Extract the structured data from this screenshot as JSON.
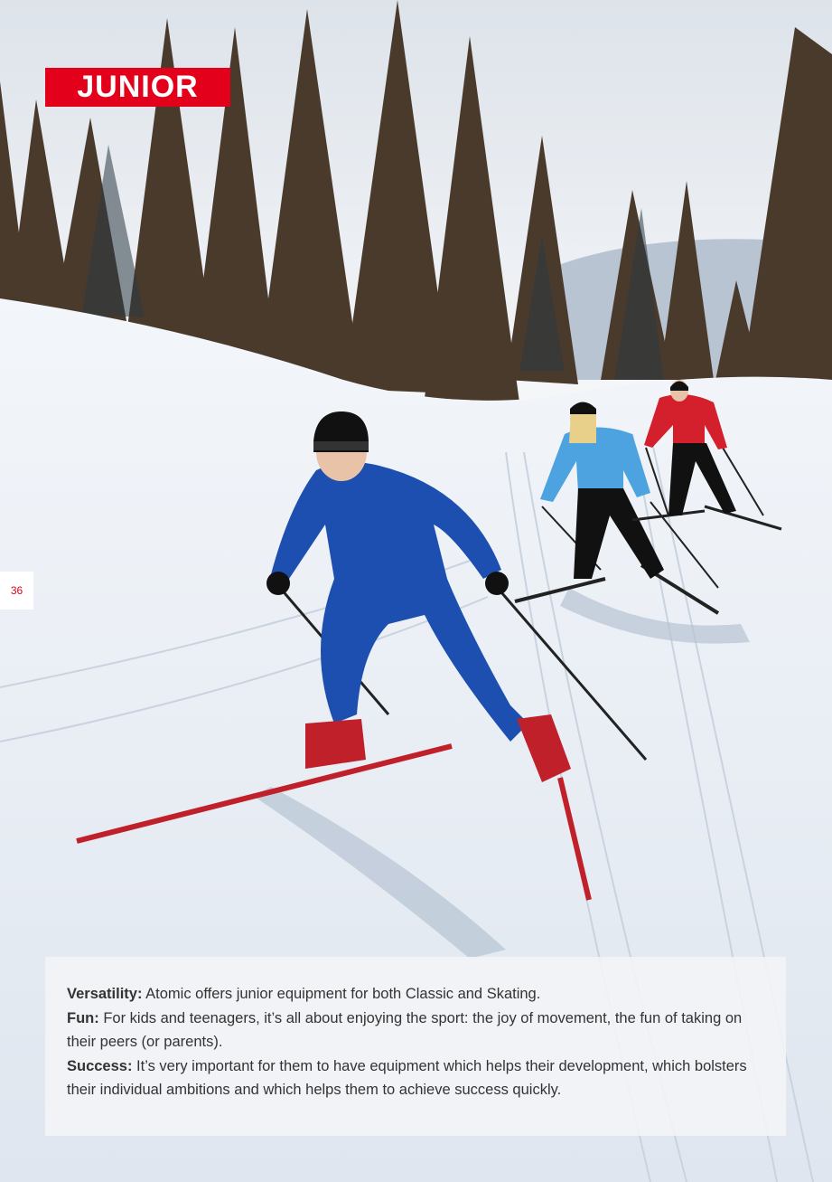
{
  "page": {
    "title": "JUNIOR",
    "page_number": "36"
  },
  "colors": {
    "accent": "#e3001b",
    "snow": "#eef2f7",
    "sky": "#f4f6f8",
    "skier_main_suit": "#1d4fb0",
    "skier_blonde_jacket": "#4da3e0",
    "skier_right_jacket": "#d4202c"
  },
  "text": {
    "paragraphs": [
      {
        "label": "Versatility:",
        "body": " Atomic offers junior equipment for both Classic and Skating."
      },
      {
        "label": "Fun:",
        "body": " For kids and teenagers, it’s all about enjoying the sport: the joy of movement, the fun of taking on their peers (or parents)."
      },
      {
        "label": "Success:",
        "body": " It’s very important for them to have equipment which helps their development, which bolsters their individual ambitions and which helps them to achieve success quickly."
      }
    ]
  }
}
